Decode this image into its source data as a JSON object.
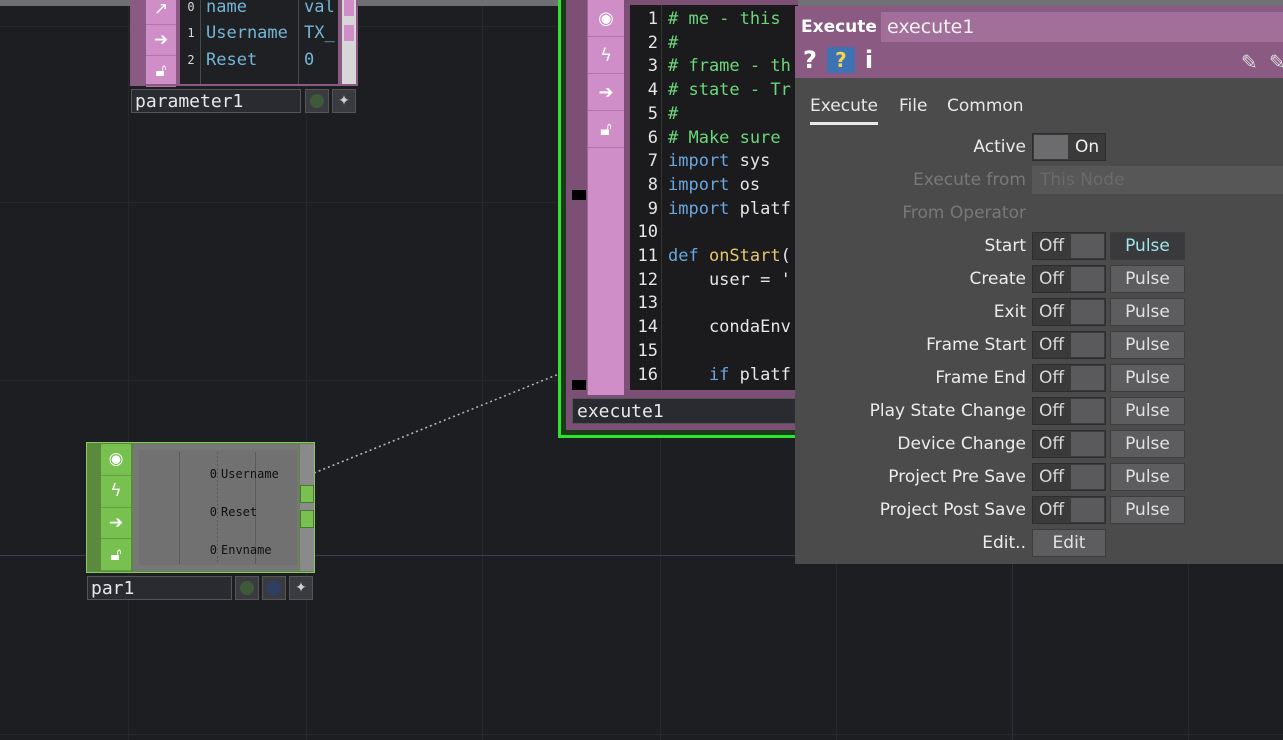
{
  "parameter1": {
    "name": "parameter1",
    "icons": [
      "viewer-icon",
      "arrow-right-icon",
      "lock-icon"
    ],
    "rows": [
      {
        "index": "0",
        "name": "name",
        "value": "val"
      },
      {
        "index": "1",
        "name": "Username",
        "value": "TX_"
      },
      {
        "index": "2",
        "name": "Reset",
        "value": "0"
      }
    ]
  },
  "execute1": {
    "name": "execute1",
    "icons": [
      "viewer-icon",
      "activity-icon",
      "arrow-right-icon",
      "lock-icon"
    ],
    "code": [
      {
        "n": "1",
        "t": "# me - this"
      },
      {
        "n": "2",
        "t": "#"
      },
      {
        "n": "3",
        "t": "# frame - th"
      },
      {
        "n": "4",
        "t": "# state - Tr"
      },
      {
        "n": "5",
        "t": "#"
      },
      {
        "n": "6",
        "t": "# Make sure"
      },
      {
        "n": "7",
        "kw": "import",
        "t": " sys"
      },
      {
        "n": "8",
        "kw": "import",
        "t": " os"
      },
      {
        "n": "9",
        "kw": "import",
        "t": " platf"
      },
      {
        "n": "10",
        "t": ""
      },
      {
        "n": "11",
        "kw": "def",
        "fn": " onStart",
        "t": "("
      },
      {
        "n": "12",
        "t": "    user = '"
      },
      {
        "n": "13",
        "t": ""
      },
      {
        "n": "14",
        "t": "    condaEnv"
      },
      {
        "n": "15",
        "t": ""
      },
      {
        "n": "16",
        "kw": "    if",
        "t": " platf"
      }
    ]
  },
  "par1": {
    "name": "par1",
    "icons": [
      "viewer-icon",
      "activity-icon",
      "arrow-right-icon",
      "lock-icon"
    ],
    "rows": [
      {
        "value": "0",
        "name": "Username"
      },
      {
        "value": "0",
        "name": "Reset"
      },
      {
        "value": "0",
        "name": "Envname"
      }
    ]
  },
  "dialog": {
    "type": "Execute",
    "name": "execute1",
    "tabs": [
      "Execute",
      "File",
      "Common"
    ],
    "active_tab": "Execute",
    "params": {
      "active": {
        "label": "Active",
        "value": "On"
      },
      "execute_from": {
        "label": "Execute from",
        "value": "This Node"
      },
      "from_operator": {
        "label": "From Operator"
      },
      "pulse_rows": [
        {
          "label": "Start",
          "value": "Off",
          "pulse": "Pulse"
        },
        {
          "label": "Create",
          "value": "Off",
          "pulse": "Pulse"
        },
        {
          "label": "Exit",
          "value": "Off",
          "pulse": "Pulse"
        },
        {
          "label": "Frame Start",
          "value": "Off",
          "pulse": "Pulse"
        },
        {
          "label": "Frame End",
          "value": "Off",
          "pulse": "Pulse"
        },
        {
          "label": "Play State Change",
          "value": "Off",
          "pulse": "Pulse"
        },
        {
          "label": "Device Change",
          "value": "Off",
          "pulse": "Pulse"
        },
        {
          "label": "Project Pre Save",
          "value": "Off",
          "pulse": "Pulse"
        },
        {
          "label": "Project Post Save",
          "value": "Off",
          "pulse": "Pulse"
        }
      ],
      "edit": {
        "label": "Edit..",
        "button": "Edit"
      }
    }
  },
  "colors": {
    "background": "#1d1e22",
    "dat_family": "#cf8ec7",
    "chop_family": "#78c050",
    "selected_border": "#2ce62c",
    "dialog_header": "#8b5a82"
  }
}
